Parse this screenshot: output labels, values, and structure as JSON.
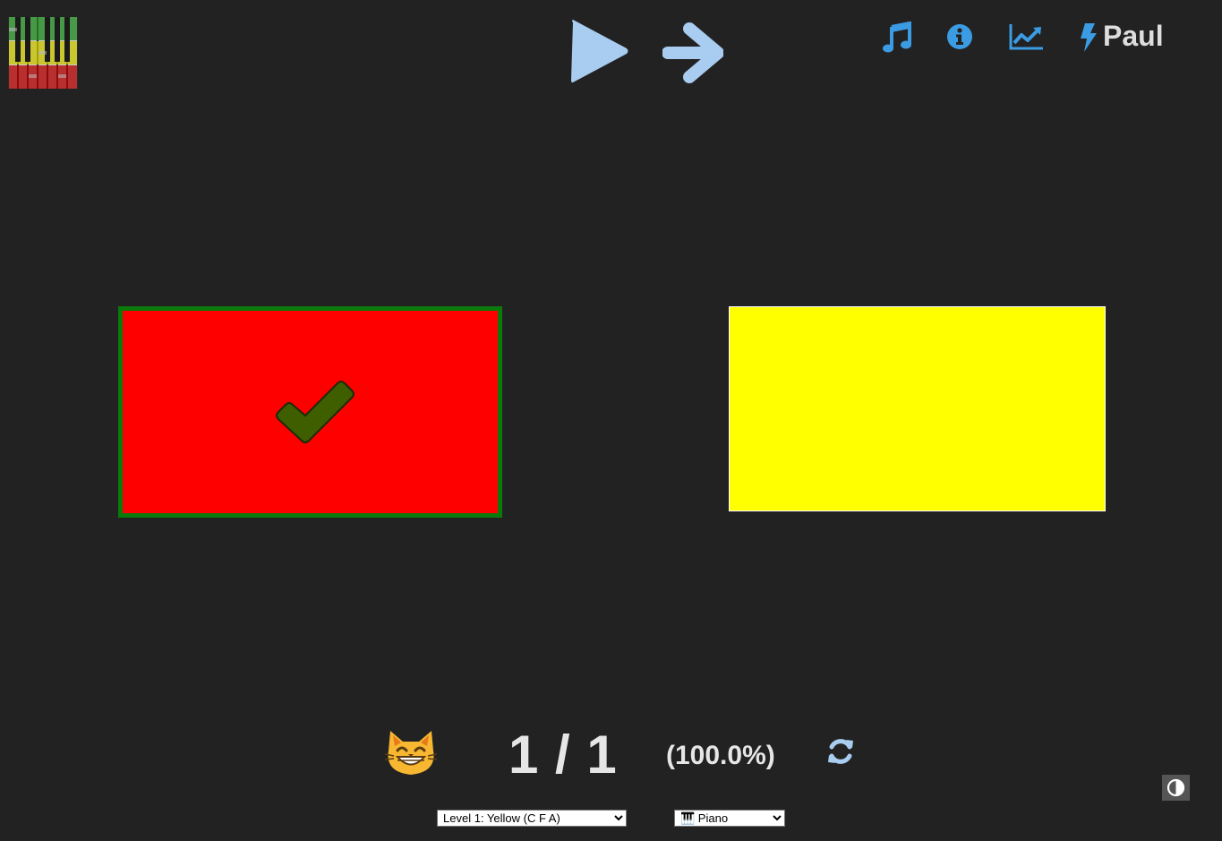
{
  "header": {
    "logo_icon": "piano-keys-logo",
    "play_icon": "play-icon",
    "next_icon": "arrow-right-icon",
    "nav": [
      {
        "icon": "music-note-icon"
      },
      {
        "icon": "info-icon"
      },
      {
        "icon": "chart-line-icon"
      },
      {
        "icon": "bolt-icon"
      }
    ],
    "user_name": "Paul",
    "icon_color": "#3b9be3",
    "light_icon_color": "#a9cdf0"
  },
  "choices": [
    {
      "color": "#ff0000",
      "selected": true,
      "correct": true,
      "mark_icon": "check-icon"
    },
    {
      "color": "#ffff00",
      "selected": false
    }
  ],
  "score": {
    "emoji": "grinning-cat-emoji",
    "text": "1 / 1",
    "correct": 1,
    "total": 1,
    "percent_text": "(100.0%)",
    "reset_icon": "refresh-icon"
  },
  "controls": {
    "level_selected": "Level 1: Yellow (C F A)",
    "instrument_selected": "🎹 Piano",
    "contrast_icon": "contrast-icon"
  }
}
